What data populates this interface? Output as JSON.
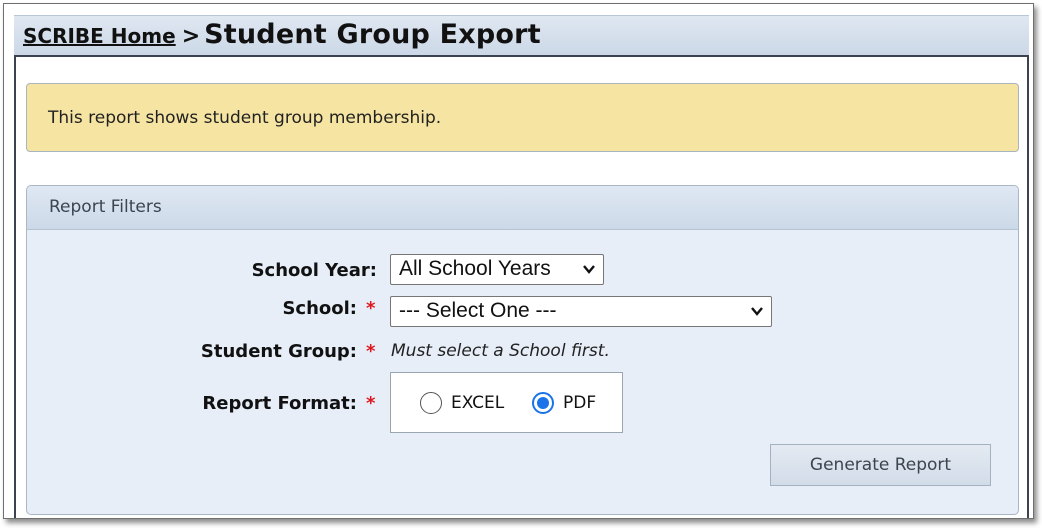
{
  "breadcrumb": {
    "home_link": "SCRIBE Home",
    "separator": ">",
    "page_title": "Student Group Export"
  },
  "info": {
    "message": "This report shows student group membership."
  },
  "filters": {
    "panel_title": "Report Filters",
    "school_year": {
      "label": "School Year:",
      "selected": "All School Years"
    },
    "school": {
      "label": "School:",
      "required_mark": "*",
      "selected": "--- Select One ---"
    },
    "student_group": {
      "label": "Student Group:",
      "required_mark": "*",
      "hint": "Must select a School first."
    },
    "report_format": {
      "label": "Report Format:",
      "required_mark": "*",
      "options": [
        {
          "label": "EXCEL",
          "selected": false
        },
        {
          "label": "PDF",
          "selected": true
        }
      ]
    },
    "generate_button": "Generate Report"
  },
  "colors": {
    "info_background": "#f6e4a3",
    "required_asterisk": "#e0161e",
    "radio_selected": "#1a73e8",
    "panel_background": "#e7eef8"
  }
}
